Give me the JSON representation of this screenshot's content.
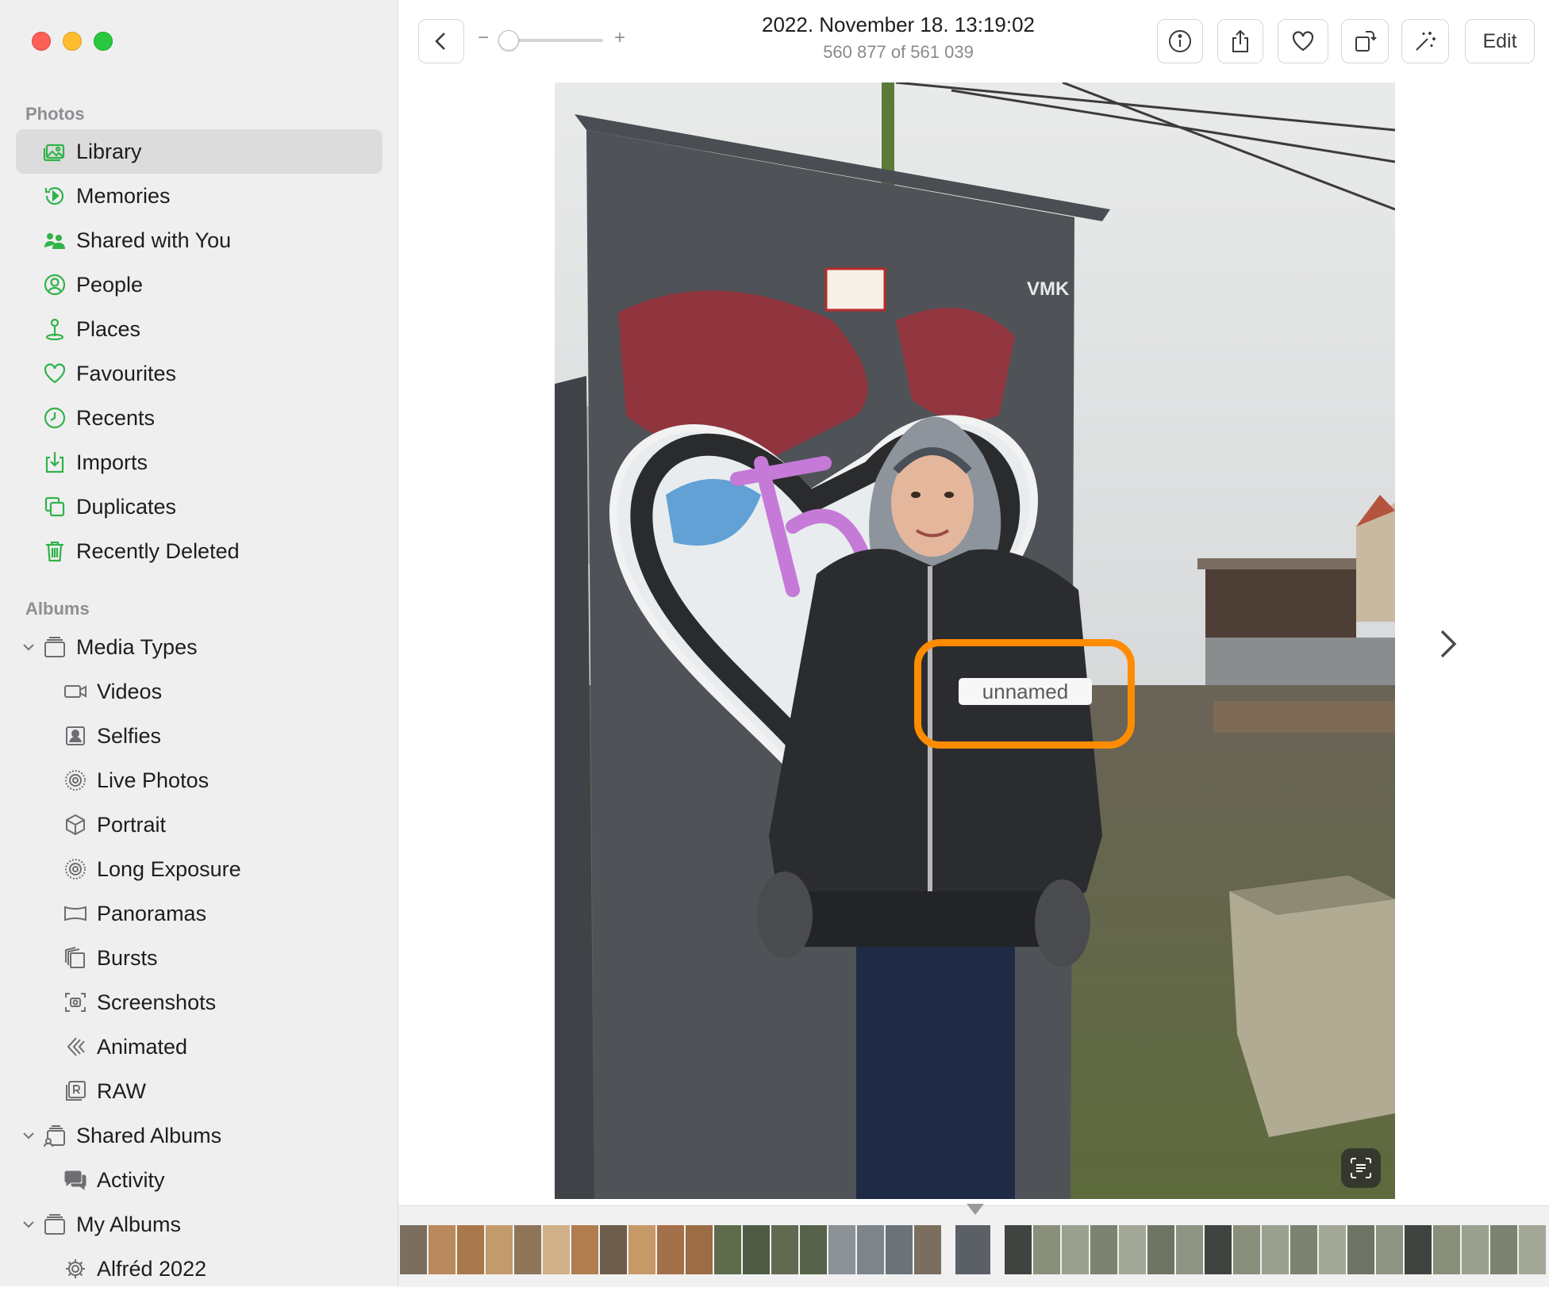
{
  "window": {
    "controls": [
      "close",
      "minimize",
      "maximize"
    ]
  },
  "sidebar": {
    "photos_header": "Photos",
    "photos_items": [
      {
        "label": "Library",
        "icon": "library-icon",
        "selected": true
      },
      {
        "label": "Memories",
        "icon": "memories-icon"
      },
      {
        "label": "Shared with You",
        "icon": "shared-with-you-icon"
      },
      {
        "label": "People",
        "icon": "people-icon"
      },
      {
        "label": "Places",
        "icon": "places-icon"
      },
      {
        "label": "Favourites",
        "icon": "heart-icon"
      },
      {
        "label": "Recents",
        "icon": "clock-icon"
      },
      {
        "label": "Imports",
        "icon": "import-icon"
      },
      {
        "label": "Duplicates",
        "icon": "duplicates-icon"
      },
      {
        "label": "Recently Deleted",
        "icon": "trash-icon"
      }
    ],
    "albums_header": "Albums",
    "media_types": {
      "label": "Media Types",
      "expanded": true,
      "items": [
        {
          "label": "Videos",
          "icon": "video-icon"
        },
        {
          "label": "Selfies",
          "icon": "selfie-icon"
        },
        {
          "label": "Live Photos",
          "icon": "live-photo-icon"
        },
        {
          "label": "Portrait",
          "icon": "portrait-cube-icon"
        },
        {
          "label": "Long Exposure",
          "icon": "long-exposure-icon"
        },
        {
          "label": "Panoramas",
          "icon": "panorama-icon"
        },
        {
          "label": "Bursts",
          "icon": "bursts-icon"
        },
        {
          "label": "Screenshots",
          "icon": "screenshot-icon"
        },
        {
          "label": "Animated",
          "icon": "animated-icon"
        },
        {
          "label": "RAW",
          "icon": "raw-icon"
        }
      ]
    },
    "shared_albums": {
      "label": "Shared Albums",
      "expanded": true,
      "items": [
        {
          "label": "Activity",
          "icon": "activity-icon"
        }
      ]
    },
    "my_albums": {
      "label": "My Albums",
      "expanded": true,
      "items": [
        {
          "label": "Alfréd 2022",
          "icon": "smart-album-gear-icon"
        }
      ]
    }
  },
  "toolbar": {
    "date_title": "2022. November 18. 13:19:02",
    "position_text": "560 877 of 561 039",
    "zoom_minus": "−",
    "zoom_plus": "+",
    "edit_label": "Edit"
  },
  "viewer": {
    "face_label": "unnamed",
    "highlight_color": "#ff8c00"
  },
  "colors": {
    "accent_green": "#30b34a",
    "sidebar_bg": "#f0eff0",
    "selected_bg": "#dcdcdc"
  }
}
